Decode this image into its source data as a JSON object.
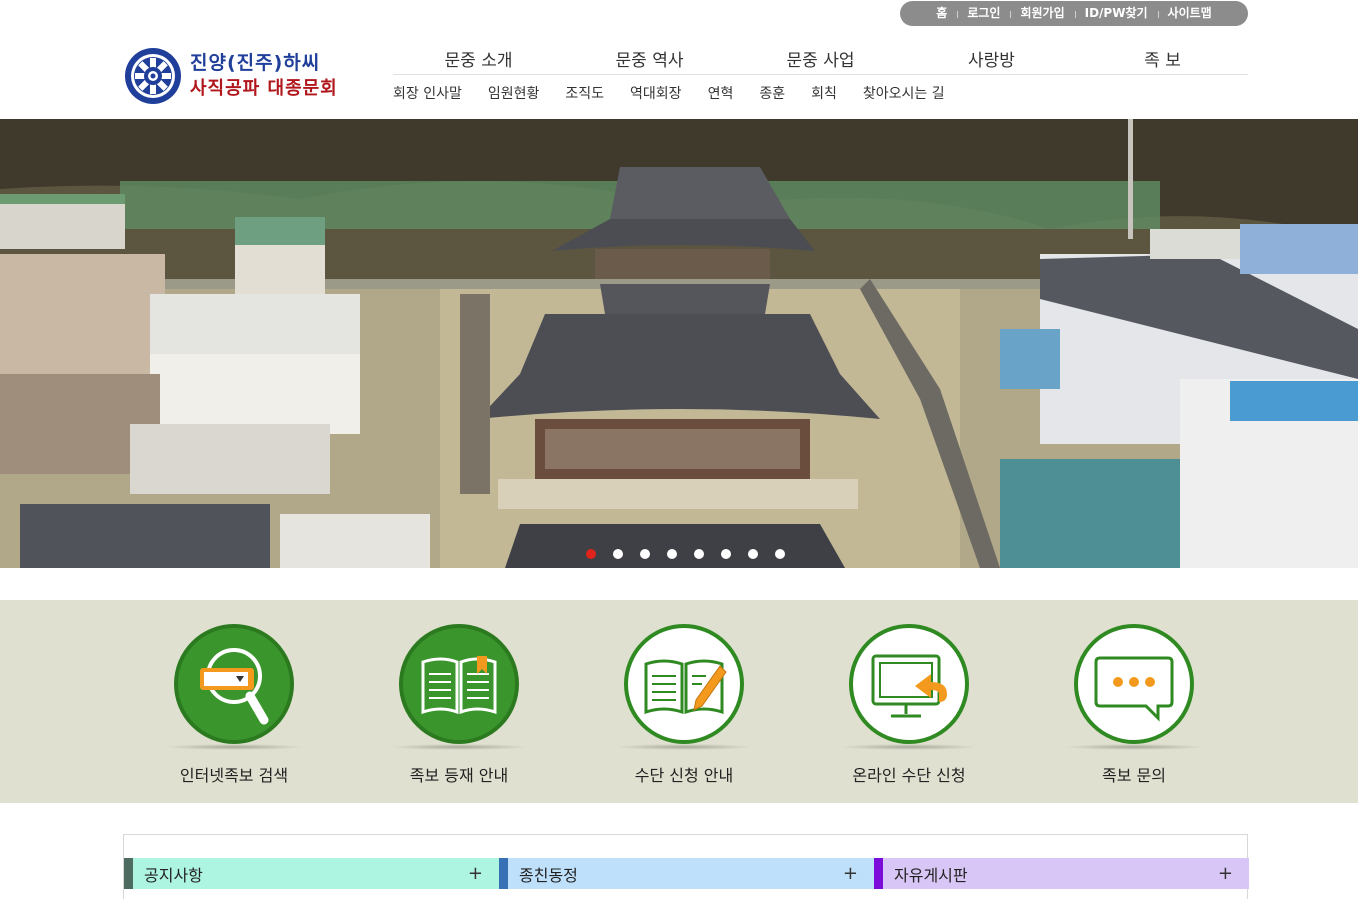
{
  "util_nav": [
    "홈",
    "로그인",
    "회원가입",
    "ID/PW찾기",
    "사이트맵"
  ],
  "logo": {
    "line1": "진양(진주)하씨",
    "line2": "사직공파 대종문회",
    "emblem": "clan-emblem-icon"
  },
  "main_nav": [
    "문중 소개",
    "문중 역사",
    "문중 사업",
    "사랑방",
    "족 보"
  ],
  "sub_nav": [
    "회장 인사말",
    "임원현황",
    "조직도",
    "역대회장",
    "연혁",
    "종훈",
    "회칙",
    "찾아오시는 길"
  ],
  "slider": {
    "image": "hanok-shrine-aerial-photo",
    "slide_count": 8,
    "active_slide": 1,
    "active_color": "#e0241c"
  },
  "quick_menu": [
    {
      "label": "인터넷족보 검색",
      "icon": "search-magnifier-icon",
      "style": "filled"
    },
    {
      "label": "족보 등재 안내",
      "icon": "book-icon",
      "style": "filled"
    },
    {
      "label": "수단 신청 안내",
      "icon": "book-pen-icon",
      "style": "outline"
    },
    {
      "label": "온라인 수단 신청",
      "icon": "monitor-arrow-icon",
      "style": "outline"
    },
    {
      "label": "족보 문의",
      "icon": "chat-bubble-icon",
      "style": "outline"
    }
  ],
  "boards": [
    {
      "title": "공지사항",
      "more": "+",
      "bg": "#adf5e1",
      "accent": "#4e6b5f"
    },
    {
      "title": "종친동정",
      "more": "+",
      "bg": "#bfe0fb",
      "accent": "#3770b5"
    },
    {
      "title": "자유게시판",
      "more": "+",
      "bg": "#d8c6f6",
      "accent": "#7a0bd8"
    }
  ],
  "colors": {
    "quick_bg": "#e0e0d0",
    "green": "#3a962c",
    "orange": "#f39a1e",
    "logo_blue": "#1f3f9a",
    "logo_red": "#b0161b"
  }
}
